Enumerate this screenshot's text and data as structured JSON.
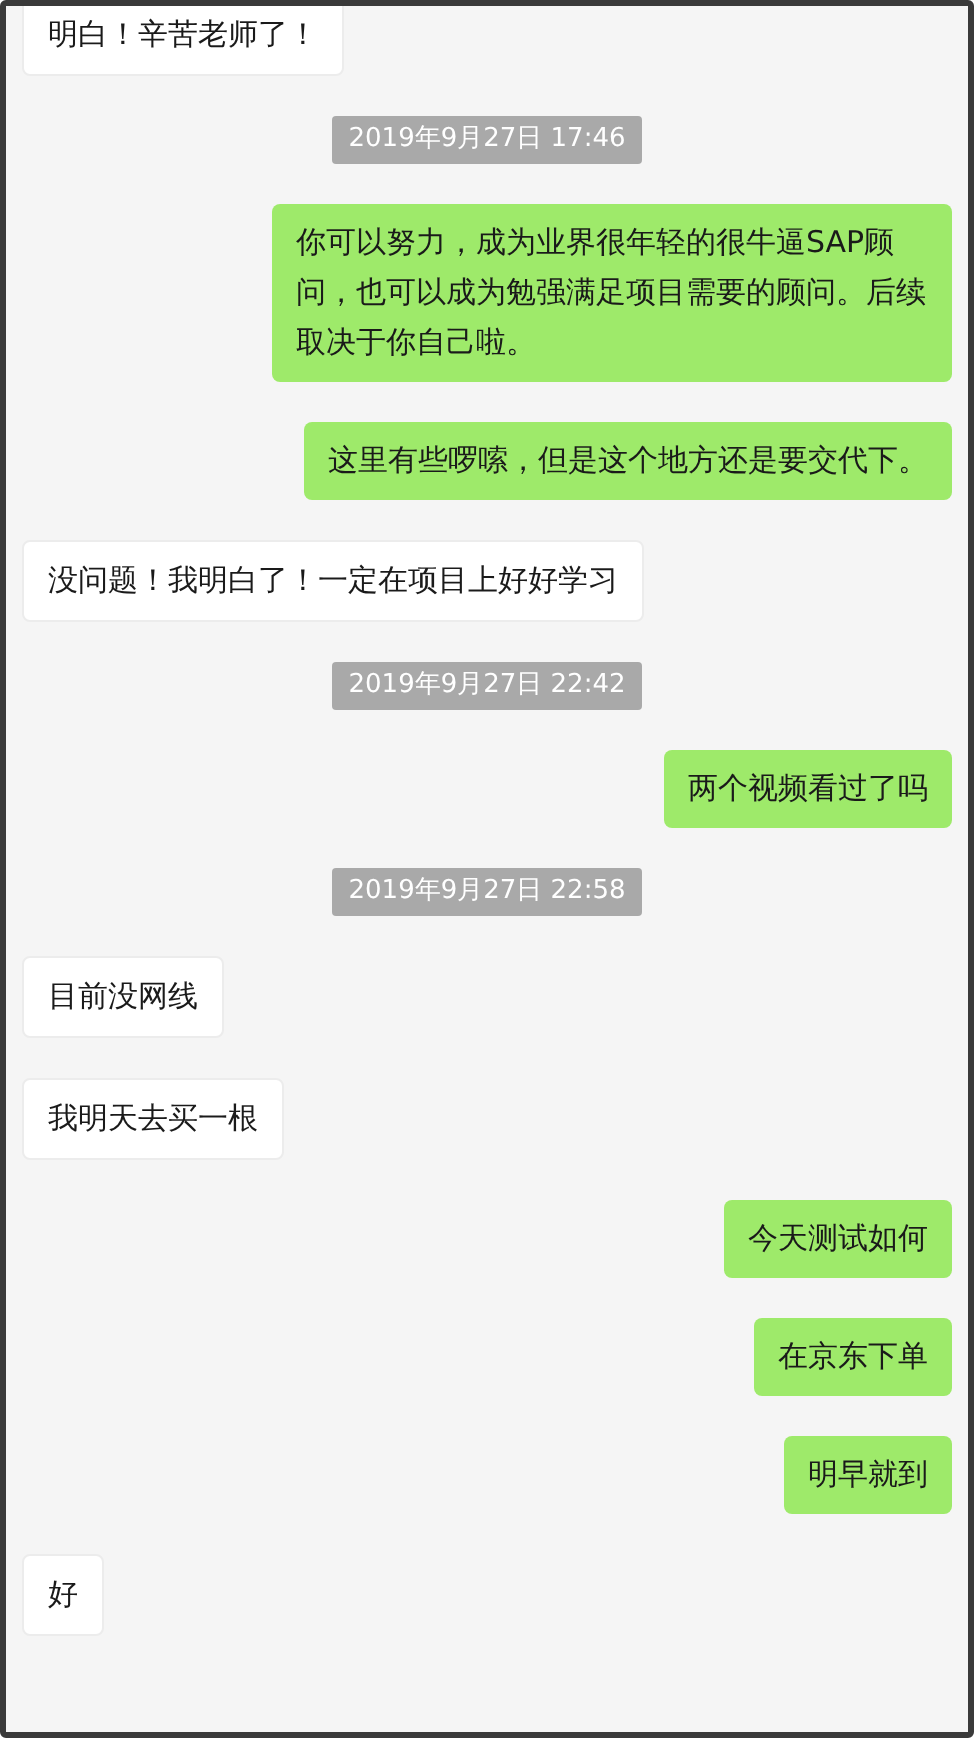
{
  "messages": [
    {
      "kind": "received",
      "text": "明白！辛苦老师了！"
    },
    {
      "kind": "time",
      "text": "2019年9月27日 17:46"
    },
    {
      "kind": "sent",
      "text": "你可以努力，成为业界很年轻的很牛逼SAP顾问，也可以成为勉强满足项目需要的顾问。后续取决于你自己啦。"
    },
    {
      "kind": "sent",
      "text": "这里有些啰嗦，但是这个地方还是要交代下。"
    },
    {
      "kind": "received",
      "text": "没问题！我明白了！一定在项目上好好学习"
    },
    {
      "kind": "time",
      "text": "2019年9月27日 22:42"
    },
    {
      "kind": "sent",
      "text": "两个视频看过了吗"
    },
    {
      "kind": "time",
      "text": "2019年9月27日 22:58"
    },
    {
      "kind": "received",
      "text": "目前没网线"
    },
    {
      "kind": "received",
      "text": "我明天去买一根"
    },
    {
      "kind": "sent",
      "text": "今天测试如何"
    },
    {
      "kind": "sent",
      "text": "在京东下单"
    },
    {
      "kind": "sent",
      "text": "明早就到"
    },
    {
      "kind": "received",
      "text": "好"
    }
  ]
}
